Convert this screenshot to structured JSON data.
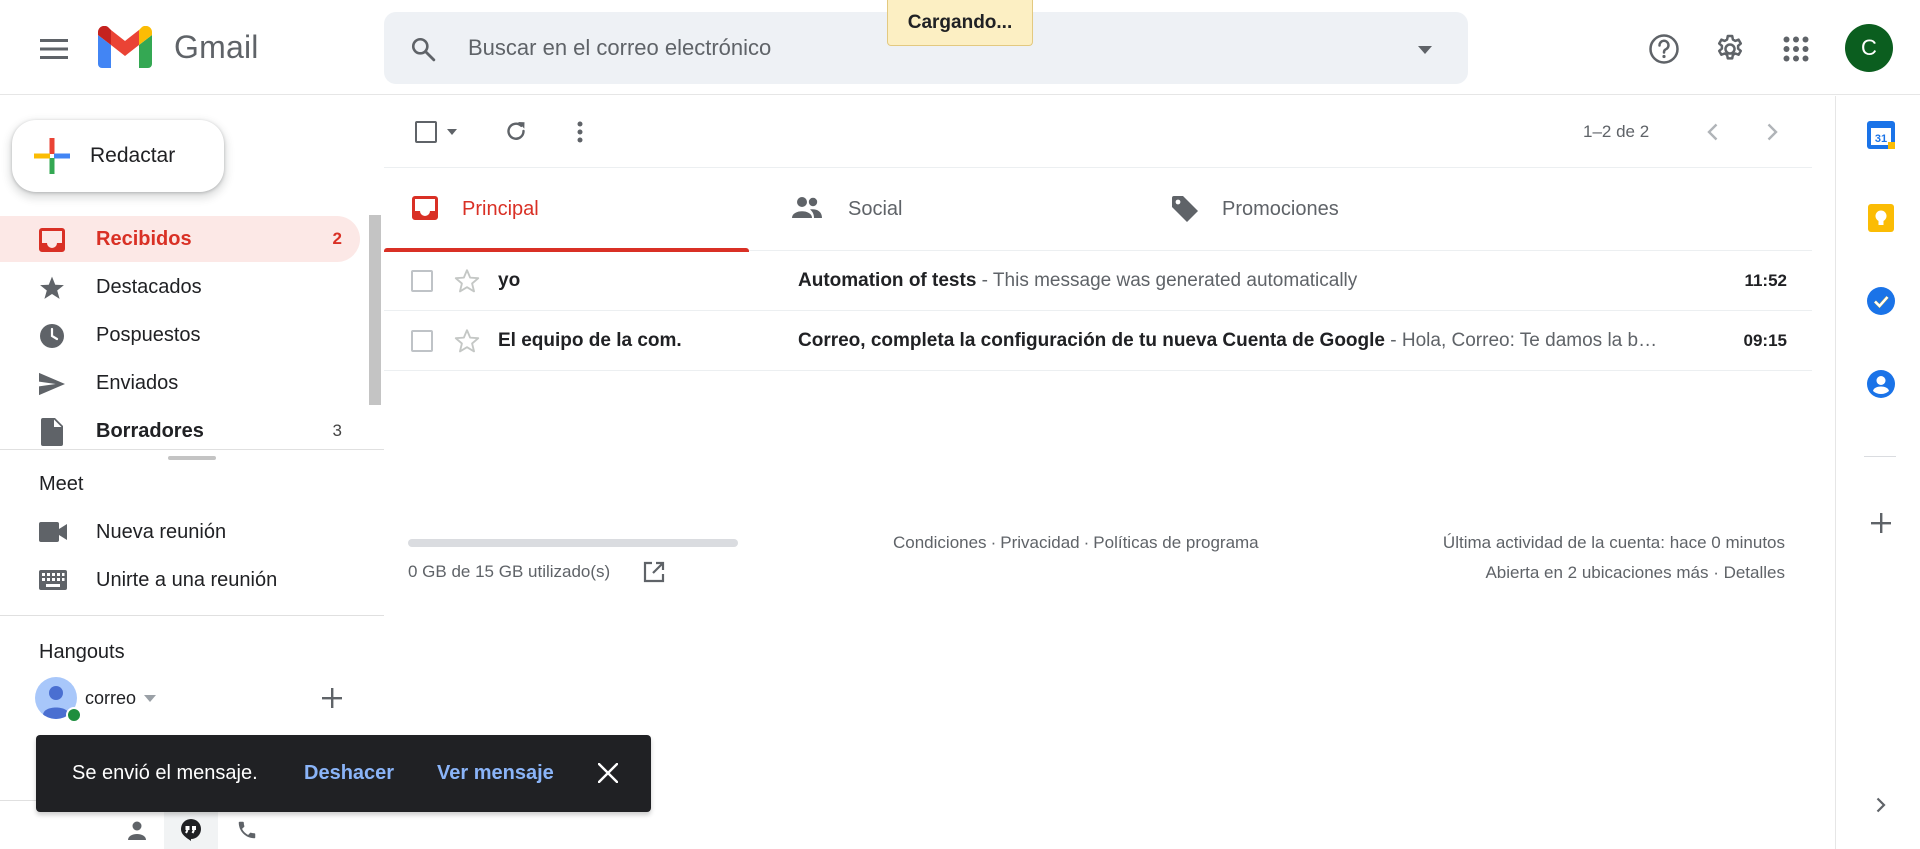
{
  "app": {
    "name": "Gmail"
  },
  "header": {
    "search_placeholder": "Buscar en el correo electrónico",
    "loading": "Cargando...",
    "account_initial": "C"
  },
  "colors": {
    "accent_red": "#d93025",
    "active_bg": "#fce8e6",
    "link_blue": "#8ab4f8",
    "avatar_green": "#0b5e1f"
  },
  "sidebar": {
    "compose_label": "Redactar",
    "items": [
      {
        "label": "Recibidos",
        "count": "2",
        "icon": "inbox-icon",
        "active": true
      },
      {
        "label": "Destacados",
        "count": "",
        "icon": "star-icon"
      },
      {
        "label": "Pospuestos",
        "count": "",
        "icon": "clock-icon"
      },
      {
        "label": "Enviados",
        "count": "",
        "icon": "send-icon"
      },
      {
        "label": "Borradores",
        "count": "3",
        "icon": "draft-icon",
        "bold": true
      }
    ],
    "meet": {
      "title": "Meet",
      "items": [
        {
          "label": "Nueva reunión",
          "icon": "video-camera-icon"
        },
        {
          "label": "Unirte a una reunión",
          "icon": "keyboard-icon"
        }
      ]
    },
    "hangouts": {
      "title": "Hangouts",
      "user_name": "correo"
    }
  },
  "toolbar": {
    "pager": "1–2 de 2"
  },
  "tabs": [
    {
      "label": "Principal",
      "icon": "inbox-icon",
      "active": true
    },
    {
      "label": "Social",
      "icon": "people-icon"
    },
    {
      "label": "Promociones",
      "icon": "tag-icon"
    }
  ],
  "emails": [
    {
      "sender": "yo",
      "subject": "Automation of tests",
      "snippet": " - This message was generated automatically",
      "time": "11:52"
    },
    {
      "sender": "El equipo de la com.",
      "subject": "Correo, completa la configuración de tu nueva Cuenta de Google",
      "snippet": " - Hola, Correo: Te damos la bienvenida a tu nueva Cuenta de Google",
      "time": "09:15"
    }
  ],
  "footer": {
    "storage": "0 GB de 15 GB utilizado(s)",
    "storage_used_fraction": 0,
    "links": [
      "Condiciones",
      "Privacidad",
      "Políticas de programa"
    ],
    "activity_line1": "Última actividad de la cuenta: hace 0 minutos",
    "activity_line2": "Abierta en 2 ubicaciones más · Detalles"
  },
  "snackbar": {
    "message": "Se envió el mensaje.",
    "undo": "Deshacer",
    "view": "Ver mensaje"
  }
}
